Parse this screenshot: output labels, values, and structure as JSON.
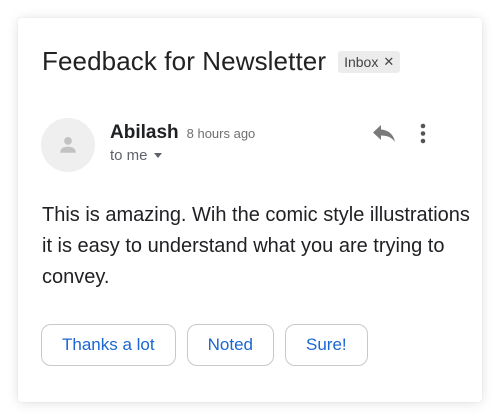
{
  "email": {
    "subject": "Feedback for Newsletter",
    "label": "Inbox",
    "sender_name": "Abilash",
    "timestamp": "8 hours ago",
    "recipient": "to me",
    "body": "This is amazing. Wih the comic style illustrations it is easy to understand what you are trying to convey."
  },
  "smart_replies": [
    "Thanks a lot",
    "Noted",
    "Sure!"
  ],
  "icons": {
    "label_remove": "close-icon",
    "avatar": "person-icon",
    "reply": "reply-icon",
    "more": "more-vert-icon",
    "recipient_expand": "chevron-down-icon"
  },
  "colors": {
    "reply_chip_text": "#1a66d2",
    "label_chip_bg": "#ececec",
    "avatar_bg": "#efefef"
  }
}
